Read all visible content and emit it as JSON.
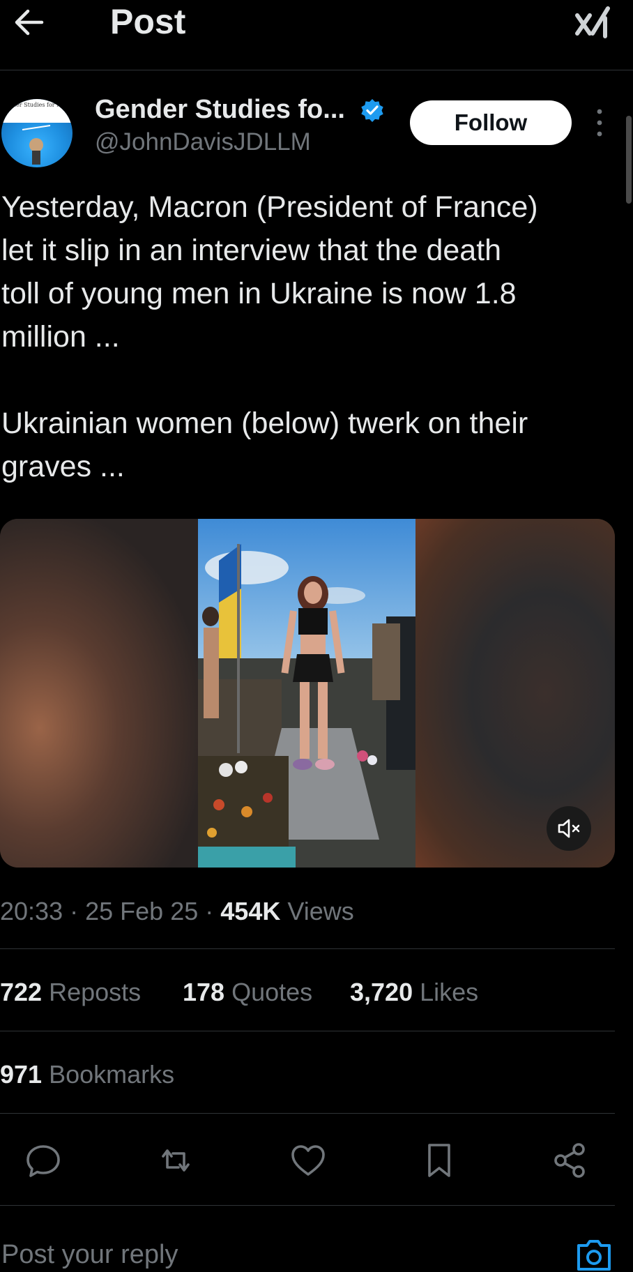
{
  "header": {
    "title": "Post",
    "back_icon": "arrow-left-icon",
    "grok_icon": "grok-icon"
  },
  "author": {
    "avatar_text": "ender Studies for Me",
    "name": "Gender Studies fo...",
    "handle": "@JohnDavisJDLLM",
    "verified": true,
    "follow_label": "Follow"
  },
  "post": {
    "text": "Yesterday, Macron (President of France)\nlet it slip in an interview that the death\ntoll of young men in Ukraine is now 1.8\nmillion ...\n\nUkrainian women (below) twerk on their\ngraves ..."
  },
  "meta": {
    "time": "20:33",
    "date": "25 Feb 25",
    "views_count": "454K",
    "views_label": "Views",
    "sep": "·"
  },
  "stats": {
    "reposts_count": "722",
    "reposts_label": "Reposts",
    "quotes_count": "178",
    "quotes_label": "Quotes",
    "likes_count": "3,720",
    "likes_label": "Likes",
    "bookmarks_count": "971",
    "bookmarks_label": "Bookmarks"
  },
  "actions": [
    "reply-icon",
    "repost-icon",
    "like-icon",
    "bookmark-icon",
    "share-icon"
  ],
  "reply": {
    "placeholder": "Post your reply"
  },
  "colors": {
    "background": "#000000",
    "text": "#e7e9ea",
    "muted": "#71767b",
    "verified": "#1d9bf0",
    "divider": "#2f3336"
  }
}
